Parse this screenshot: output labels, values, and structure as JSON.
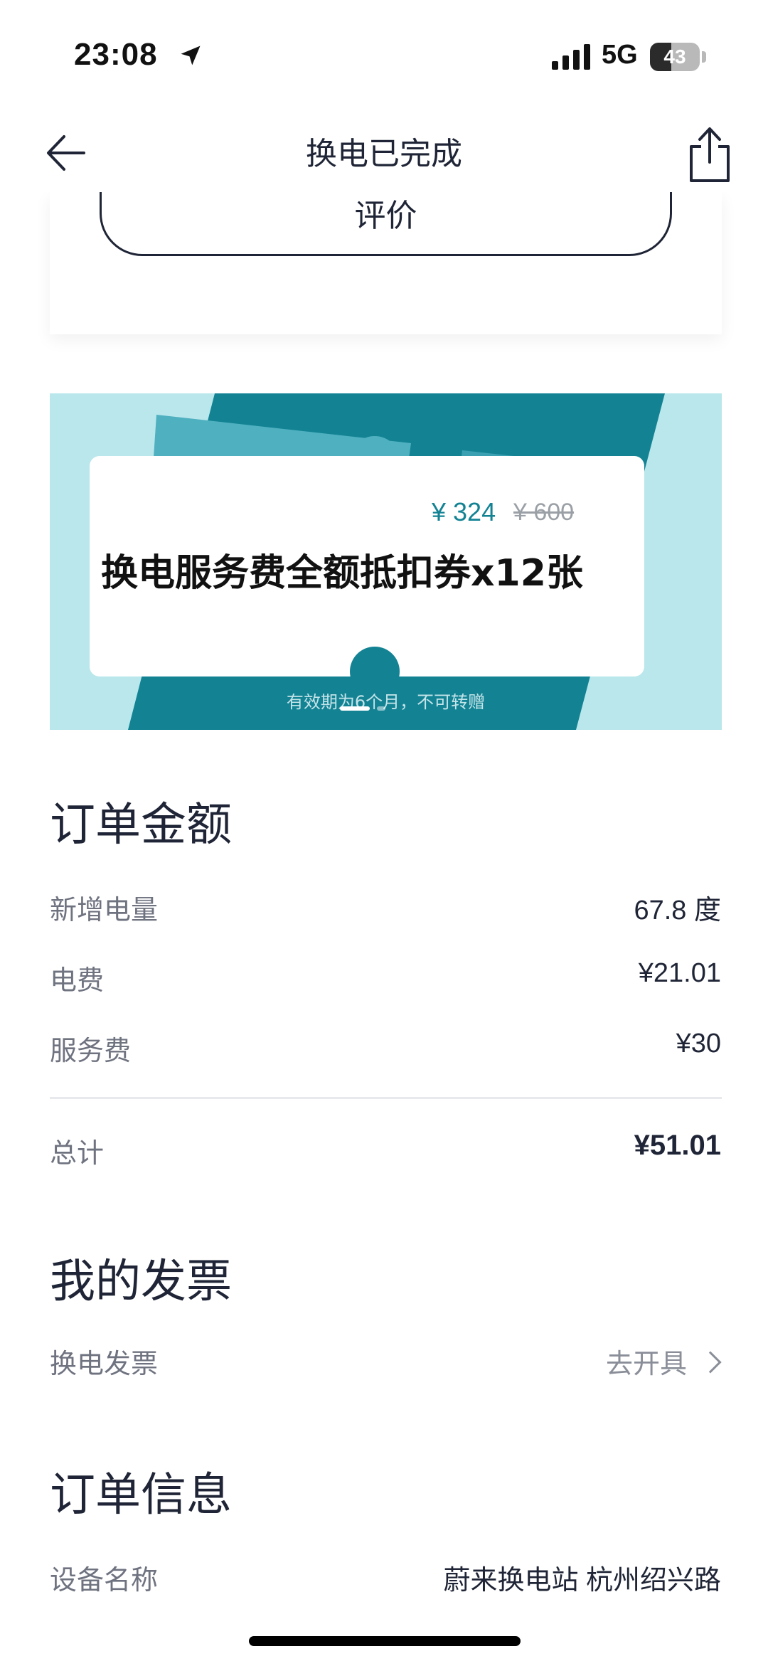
{
  "status_bar": {
    "time": "23:08",
    "network": "5G",
    "battery": "43",
    "battery_level": 0.43
  },
  "nav": {
    "title": "换电已完成",
    "back_icon": "arrow-left-icon",
    "share_icon": "share-icon"
  },
  "review": {
    "button_label": "评价"
  },
  "banner": {
    "price_now": "¥ 324",
    "price_original": "¥ 600",
    "title": "换电服务费全额抵扣券x12张",
    "validity": "有效期为6个月，不可转赠",
    "page_count": 2,
    "active_page": 0,
    "colors": {
      "light": "#b9e7ec",
      "dark": "#138394",
      "mid": "#4fb0c0"
    }
  },
  "order_amount": {
    "heading": "订单金额",
    "rows": [
      {
        "label": "新增电量",
        "value": "67.8 度"
      },
      {
        "label": "电费",
        "value": "¥21.01"
      },
      {
        "label": "服务费",
        "value": "¥30"
      }
    ],
    "total_label": "总计",
    "total_value": "¥51.01"
  },
  "invoice": {
    "heading": "我的发票",
    "row_label": "换电发票",
    "action_label": "去开具",
    "action_icon": "chevron-right-icon"
  },
  "order_info": {
    "heading": "订单信息",
    "device_label": "设备名称",
    "device_value": "蔚来换电站 杭州绍兴路"
  }
}
